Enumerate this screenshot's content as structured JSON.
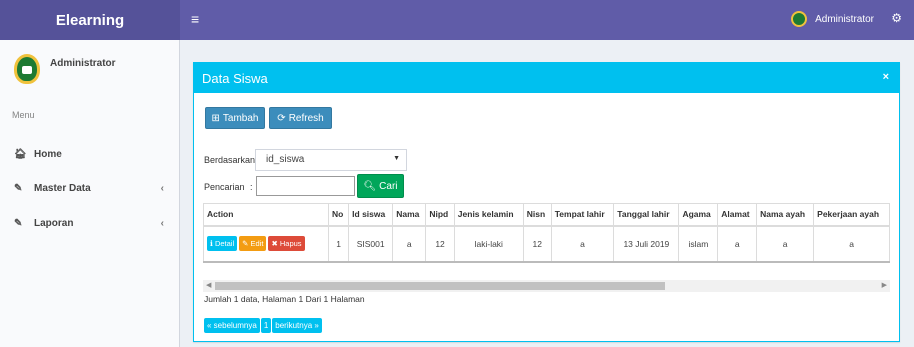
{
  "app": {
    "title": "Elearning",
    "menu_icon": "≡"
  },
  "topbar": {
    "user_name": "Administrator"
  },
  "sidebar": {
    "user_name": "Administrator",
    "menu_label": "Menu",
    "items": [
      {
        "label": "Home",
        "icon": "home-icon"
      },
      {
        "label": "Master Data",
        "icon": "edit-icon"
      },
      {
        "label": "Laporan",
        "icon": "edit-icon"
      }
    ]
  },
  "box": {
    "title": "Data Siswa",
    "close": "×"
  },
  "toolbar": {
    "add_label": "Tambah",
    "refresh_label": "Refresh"
  },
  "filter": {
    "by_label": "Berdasarkan:",
    "by_value": "id_siswa",
    "search_label": "Pencarian",
    "search_colon": ":",
    "search_value": "",
    "search_button": "Cari"
  },
  "table": {
    "headers": [
      "Action",
      "No",
      "Id siswa",
      "Nama",
      "Nipd",
      "Jenis kelamin",
      "Nisn",
      "Tempat lahir",
      "Tanggal lahir",
      "Agama",
      "Alamat",
      "Nama ayah",
      "Pekerjaan ayah"
    ],
    "rows": [
      {
        "no": "1",
        "id_siswa": "SIS001",
        "nama": "a",
        "nipd": "12",
        "jenis_kelamin": "laki-laki",
        "nisn": "12",
        "tempat_lahir": "a",
        "tanggal_lahir": "13 Juli 2019",
        "agama": "islam",
        "alamat": "a",
        "nama_ayah": "a",
        "pekerjaan_ayah": "a"
      }
    ],
    "actions": {
      "detail": "Detail",
      "edit": "Edit",
      "hapus": "Hapus"
    }
  },
  "summary": "Jumlah 1 data, Halaman 1 Dari 1 Halaman",
  "pagination": {
    "prev": "« sebelumnya",
    "current": "1",
    "next": "berikutnya »"
  },
  "colors": {
    "topbar": "#605ca8",
    "logo_bg": "#555299",
    "box_header": "#00c0ef",
    "primary": "#3c8dbc",
    "success": "#00a65a",
    "warning": "#f39c12",
    "danger": "#dd4b39"
  }
}
